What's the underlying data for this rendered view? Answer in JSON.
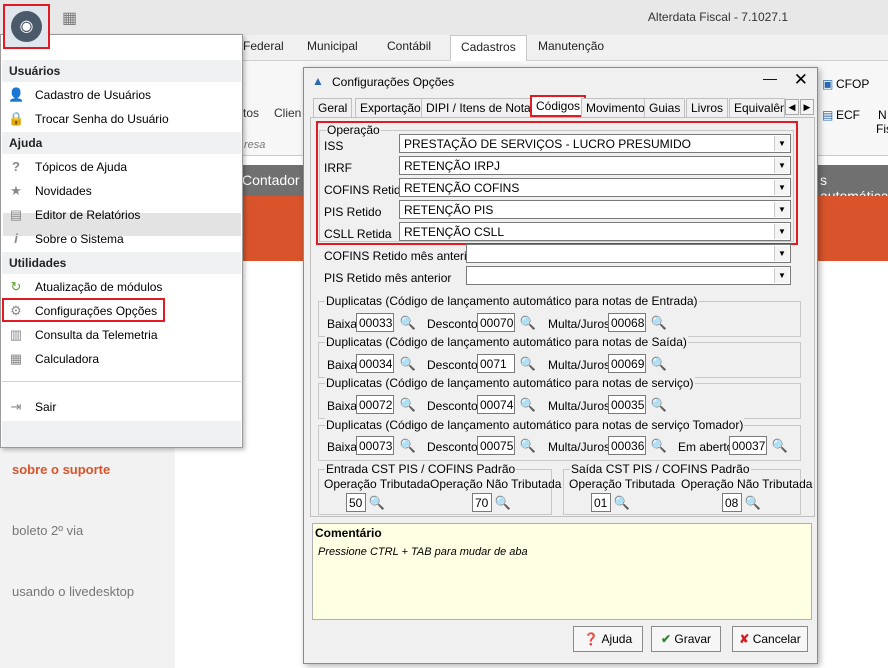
{
  "app": {
    "title": "Alterdata Fiscal - 7.1027.1"
  },
  "ribbon": {
    "tabs": [
      "Federal",
      "Municipal",
      "Contábil",
      "Cadastros",
      "Manutenção"
    ],
    "active": "Cadastros",
    "right_items": [
      "CFOP",
      "ECF",
      "N",
      "Fis"
    ],
    "frag1": "tos",
    "frag2": "Clien",
    "group_frag": "resa"
  },
  "background": {
    "contador": "Contador",
    "auto_text": "s automática",
    "side_links": [
      "sobre o suporte",
      "boleto 2º via",
      "usando o livedesktop"
    ]
  },
  "menu": {
    "sections": [
      {
        "header": "Usuários",
        "items": [
          {
            "label": "Cadastro de Usuários",
            "icon": "user-icon"
          },
          {
            "label": "Trocar Senha do Usuário",
            "icon": "lock-icon"
          }
        ]
      },
      {
        "header": "Ajuda",
        "items": [
          {
            "label": "Tópicos de Ajuda",
            "icon": "question-icon"
          },
          {
            "label": "Novidades",
            "icon": "star-icon"
          },
          {
            "label": "Editor de Relatórios",
            "icon": "report-icon"
          },
          {
            "label": "Sobre o Sistema",
            "icon": "info-icon"
          }
        ]
      },
      {
        "header": "Utilidades",
        "items": [
          {
            "label": "Atualização de módulos",
            "icon": "refresh-icon"
          },
          {
            "label": "Configurações Opções",
            "icon": "gear-icon"
          },
          {
            "label": "Consulta da Telemetria",
            "icon": "chart-icon"
          },
          {
            "label": "Calculadora",
            "icon": "calculator-icon"
          }
        ]
      }
    ],
    "exit": "Sair"
  },
  "dialog": {
    "title": "Configurações Opções",
    "tabs": [
      "Geral",
      "Exportação",
      "DIPI / Itens de Nota",
      "Códigos",
      "Movimento",
      "Guias",
      "Livros",
      "Equivalên"
    ],
    "active_tab": "Códigos",
    "operacao": {
      "title": "Operação",
      "rows": [
        {
          "label": "ISS",
          "value": "PRESTAÇÃO DE SERVIÇOS - LUCRO PRESUMIDO"
        },
        {
          "label": "IRRF",
          "value": "RETENÇÃO IRPJ"
        },
        {
          "label": "COFINS Retido",
          "value": "RETENÇÃO COFINS"
        },
        {
          "label": "PIS Retido",
          "value": "RETENÇÃO PIS"
        },
        {
          "label": "CSLL Retida",
          "value": "RETENÇÃO CSLL"
        }
      ]
    },
    "extra_rows": [
      {
        "label": "COFINS Retido mês anterior",
        "value": ""
      },
      {
        "label": "PIS Retido mês anterior",
        "value": ""
      }
    ],
    "dup_groups": [
      {
        "title": "Duplicatas (Código de  lançamento automático para notas de Entrada)",
        "baixa": "00033",
        "desconto": "00070",
        "multa": "00068"
      },
      {
        "title": "Duplicatas (Código de  lançamento automático para notas de Saída)",
        "baixa": "00034",
        "desconto": "0071",
        "multa": "00069"
      },
      {
        "title": "Duplicatas (Código de  lançamento automático para notas de serviço)",
        "baixa": "00072",
        "desconto": "00074",
        "multa": "00035"
      },
      {
        "title": "Duplicatas (Código de  lançamento automático para notas de serviço Tomador)",
        "baixa": "00073",
        "desconto": "00075",
        "multa": "00036",
        "em_aberto": "00037"
      }
    ],
    "labels": {
      "baixa": "Baixa",
      "desconto": "Desconto",
      "multa": "Multa/Juros",
      "em_aberto": "Em aberto",
      "op_trib": "Operação Tributada",
      "op_nao_trib": "Operação Não Tributada"
    },
    "cst_entrada": {
      "title": "Entrada CST PIS / COFINS Padrão",
      "trib": "50",
      "nao_trib": "70"
    },
    "cst_saida": {
      "title": "Saída CST PIS / COFINS Padrão",
      "trib": "01",
      "nao_trib": "08"
    },
    "comment": {
      "title": "Comentário",
      "text": "Pressione CTRL + TAB para  mudar de aba"
    },
    "buttons": {
      "help": "Ajuda",
      "save": "Gravar",
      "cancel": "Cancelar"
    }
  }
}
